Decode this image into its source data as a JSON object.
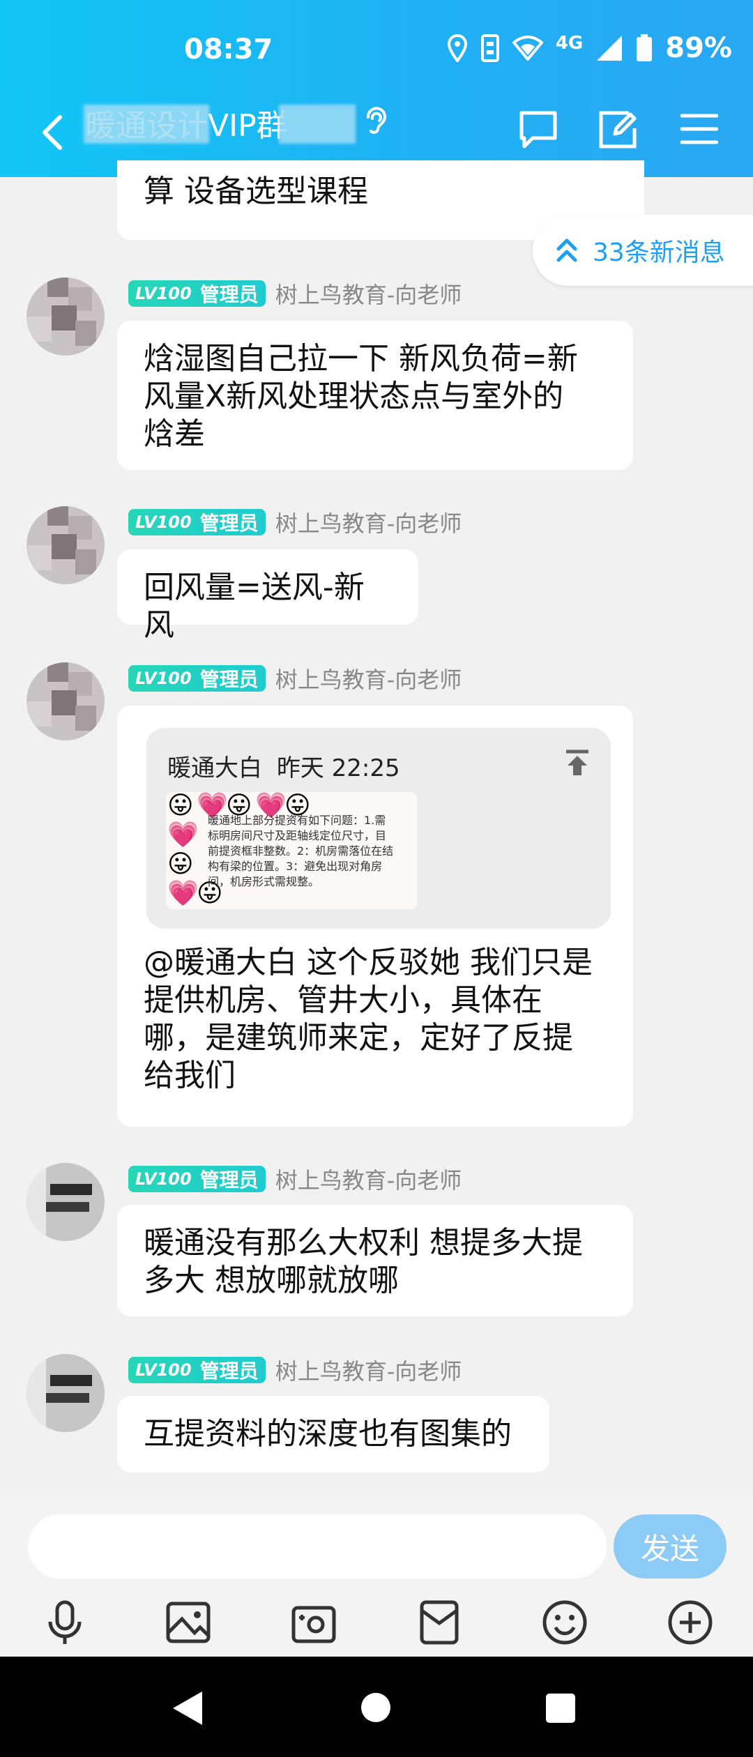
{
  "status": {
    "time": "08:37",
    "network": "4G",
    "battery": "89%"
  },
  "header": {
    "title": "暖通设计VIP群"
  },
  "new_messages": "33条新消息",
  "partial_message": "算 设备选型课程",
  "sender": {
    "level": "LV100",
    "role": "管理员",
    "name": "树上鸟教育-向老师"
  },
  "messages": [
    {
      "text_lines": [
        "焓湿图自己拉一下 新风负荷=新",
        "风量X新风处理状态点与室外的",
        "焓差"
      ]
    },
    {
      "text_lines": [
        "回风量=送风-新风"
      ]
    },
    {
      "quote": {
        "author": "暖通大白",
        "time": "昨天 22:25",
        "image_text": "暖通地上部分提资有如下问题：1.需标明房间尺寸及距轴线定位尺寸，目前提资框非整数。2：机房需落位在结构有梁的位置。3：避免出现对角房间，机房形式需规整。"
      },
      "text_lines": [
        "@暖通大白 这个反驳她 我们只是",
        "提供机房、管井大小，具体在",
        "哪，是建筑师来定，定好了反提",
        "给我们"
      ]
    },
    {
      "text_lines": [
        "暖通没有那么大权利 想提多大提",
        "多大 想放哪就放哪"
      ]
    },
    {
      "text_lines": [
        "互提资料的深度也有图集的"
      ]
    }
  ],
  "composer": {
    "send_label": "发送"
  },
  "colors": {
    "header": "#1fb1f4",
    "accent": "#1e9ff2",
    "send": "#8ccbf6",
    "badge": "#26d6b6"
  }
}
